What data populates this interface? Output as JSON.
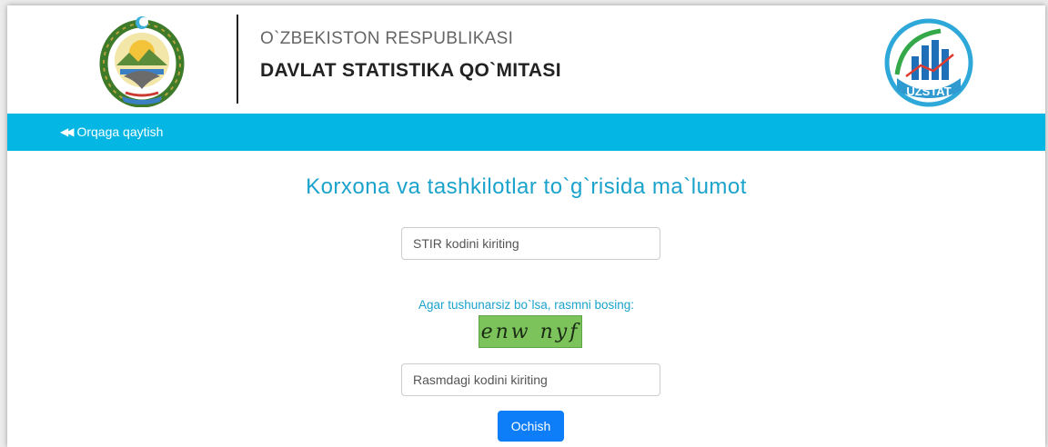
{
  "header": {
    "org_line1": "O`ZBEKISTON RESPUBLIKASI",
    "org_line2": "DAVLAT STATISTIKA QO`MITASI",
    "logo_text": "UZSTAT"
  },
  "nav": {
    "back_label": "Orqaga qaytish",
    "back_icon": "backward-icon"
  },
  "main": {
    "title": "Korxona va tashkilotlar to`g`risida ma`lumot",
    "stir_placeholder": "STIR kodini kiriting",
    "captcha_hint": "Agar tushunarsiz bo`lsa, rasmni bosing:",
    "captcha_text": "enw nyf",
    "captcha_code_placeholder": "Rasmdagi kodini kiriting",
    "submit_label": "Ochish"
  },
  "colors": {
    "navbar": "#03b6e4",
    "title": "#1ba3cc",
    "button": "#0d7ef7",
    "captcha_bg": "#7bc35a"
  }
}
